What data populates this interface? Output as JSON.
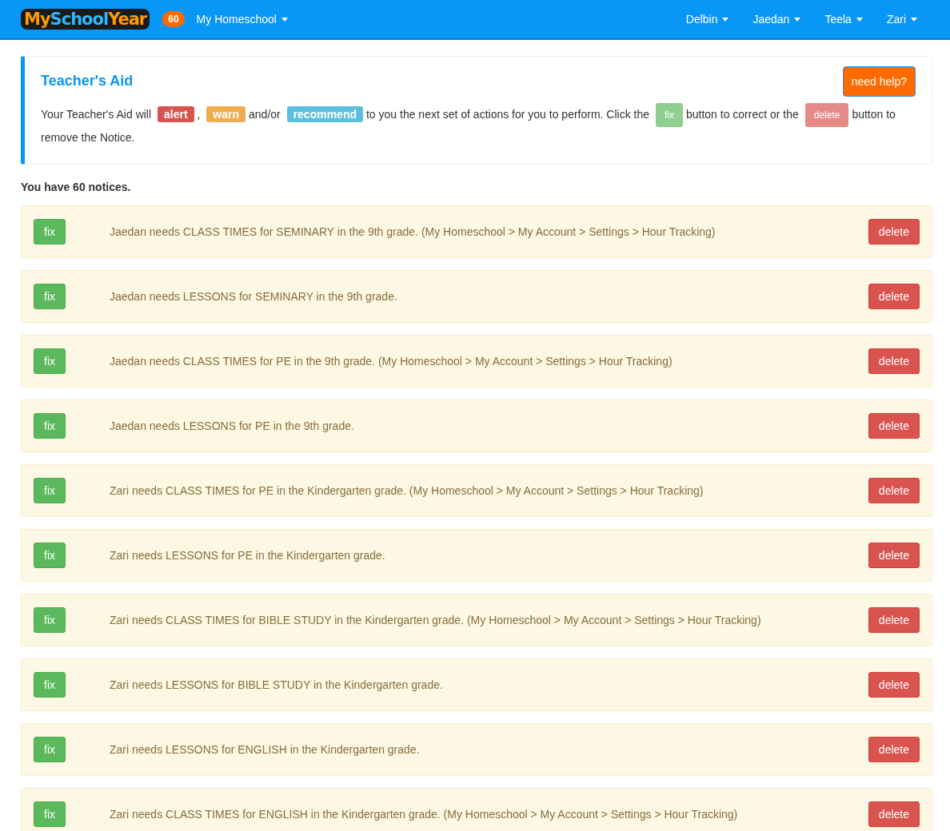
{
  "navbar": {
    "logo": [
      "My",
      "School",
      "Year"
    ],
    "notice_count": "60",
    "menu": "My Homeschool",
    "users": [
      "Delbin",
      "Jaedan",
      "Teela",
      "Zari"
    ]
  },
  "teachers_aid": {
    "title": "Teacher's Aid",
    "help_button": "need help?",
    "intro": [
      {
        "kind": "text",
        "text": "Your Teacher's Aid will"
      },
      {
        "kind": "badge",
        "text": "alert",
        "color": "#d9534f"
      },
      {
        "kind": "text",
        "text": ","
      },
      {
        "kind": "badge",
        "text": "warn",
        "color": "#f0ad4e"
      },
      {
        "kind": "text",
        "text": "and/or"
      },
      {
        "kind": "badge",
        "text": "recommend",
        "color": "#5bc0de"
      },
      {
        "kind": "text",
        "text": "to you the next set of actions for you to perform. Click the"
      },
      {
        "kind": "button",
        "text": "fix",
        "color": "#91cf91"
      },
      {
        "kind": "text",
        "text": "button to correct or the"
      },
      {
        "kind": "button",
        "text": "delete",
        "color": "#e68a88"
      },
      {
        "kind": "text",
        "text": "button to"
      },
      {
        "kind": "text",
        "text": "remove the Notice."
      }
    ]
  },
  "summary": "You have 60 notices.",
  "notices": [
    {
      "fix": "fix",
      "text": "Jaedan needs CLASS TIMES for SEMINARY in the 9th grade. (My Homeschool > My Account > Settings > Hour Tracking)",
      "delete": "delete"
    },
    {
      "fix": "fix",
      "text": "Jaedan needs LESSONS for SEMINARY in the 9th grade.",
      "delete": "delete"
    },
    {
      "fix": "fix",
      "text": "Jaedan needs CLASS TIMES for PE in the 9th grade. (My Homeschool > My Account > Settings > Hour Tracking)",
      "delete": "delete"
    },
    {
      "fix": "fix",
      "text": "Jaedan needs LESSONS for PE in the 9th grade.",
      "delete": "delete"
    },
    {
      "fix": "fix",
      "text": "Zari needs CLASS TIMES for PE in the Kindergarten grade. (My Homeschool > My Account > Settings > Hour Tracking)",
      "delete": "delete"
    },
    {
      "fix": "fix",
      "text": "Zari needs LESSONS for PE in the Kindergarten grade.",
      "delete": "delete"
    },
    {
      "fix": "fix",
      "text": "Zari needs CLASS TIMES for BIBLE STUDY in the Kindergarten grade. (My Homeschool > My Account > Settings > Hour Tracking)",
      "delete": "delete"
    },
    {
      "fix": "fix",
      "text": "Zari needs LESSONS for BIBLE STUDY in the Kindergarten grade.",
      "delete": "delete"
    },
    {
      "fix": "fix",
      "text": "Zari needs LESSONS for ENGLISH in the Kindergarten grade.",
      "delete": "delete"
    },
    {
      "fix": "fix",
      "text": "Zari needs CLASS TIMES for ENGLISH in the Kindergarten grade. (My Homeschool > My Account > Settings > Hour Tracking)",
      "delete": "delete"
    }
  ]
}
